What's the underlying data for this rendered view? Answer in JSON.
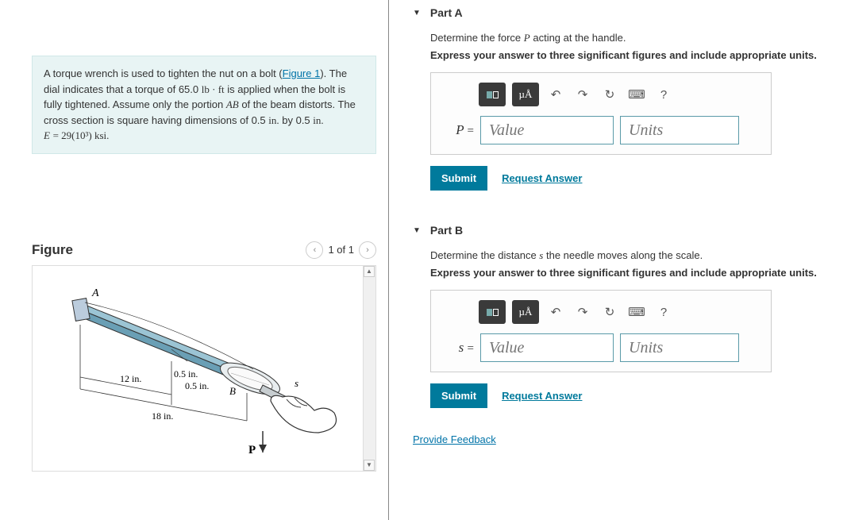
{
  "problem": {
    "text_before_link": "A torque wrench is used to tighten the nut on a bolt (",
    "link_text": "Figure 1",
    "text_after_link": "). The dial indicates that a torque of 65.0 lb · ft is applied when the bolt is fully tightened. Assume only the portion AB of the beam distorts. The cross section is square having dimensions of 0.5 in. by 0.5 in.",
    "modulus_line": "E = 29(10³) ksi."
  },
  "figure": {
    "title": "Figure",
    "count": "1 of 1",
    "labels": {
      "A": "A",
      "B": "B",
      "P": "P",
      "s": "s",
      "dim12": "12 in.",
      "dim18": "18 in.",
      "dim05a": "0.5 in.",
      "dim05b": "0.5 in."
    }
  },
  "partA": {
    "title": "Part A",
    "prompt1": "Determine the force P acting at the handle.",
    "prompt2": "Express your answer to three significant figures and include appropriate units.",
    "var": "P",
    "eq": "=",
    "value_placeholder": "Value",
    "units_placeholder": "Units",
    "submit": "Submit",
    "request": "Request Answer",
    "toolbar": {
      "units": "µÅ",
      "help": "?"
    }
  },
  "partB": {
    "title": "Part B",
    "prompt1": "Determine the distance s the needle moves along the scale.",
    "prompt2": "Express your answer to three significant figures and include appropriate units.",
    "var": "s",
    "eq": "=",
    "value_placeholder": "Value",
    "units_placeholder": "Units",
    "submit": "Submit",
    "request": "Request Answer",
    "toolbar": {
      "units": "µÅ",
      "help": "?"
    }
  },
  "feedback": "Provide Feedback"
}
